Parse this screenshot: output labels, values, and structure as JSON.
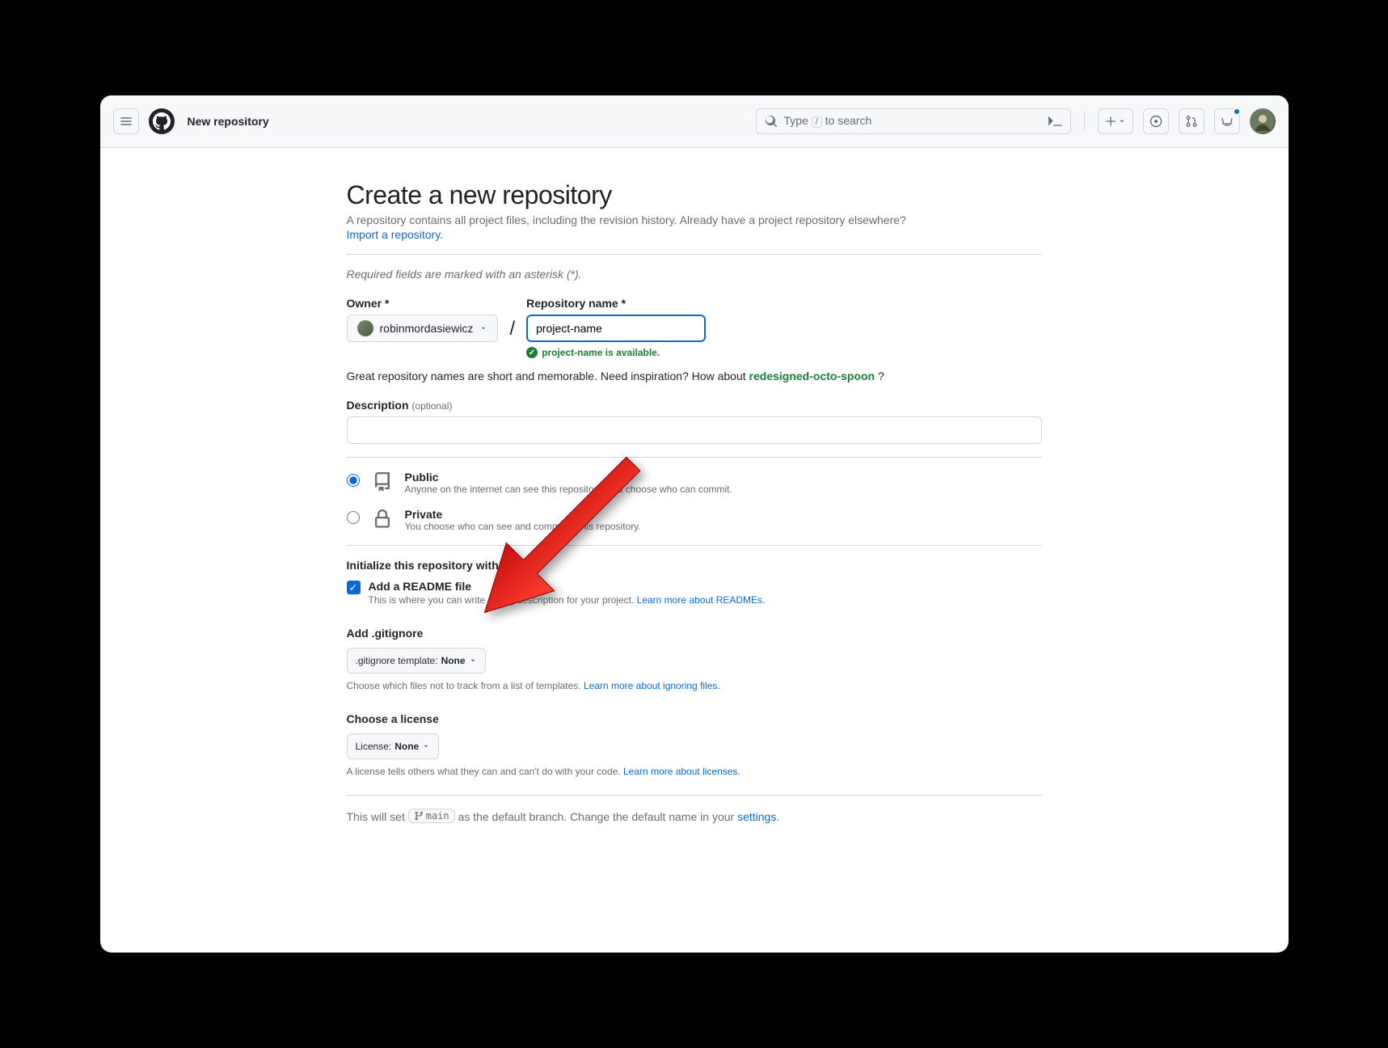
{
  "header": {
    "page_title": "New repository",
    "search_prefix": "Type",
    "search_key": "/",
    "search_suffix": "to search"
  },
  "form": {
    "heading": "Create a new repository",
    "subhead": "A repository contains all project files, including the revision history. Already have a project repository elsewhere?",
    "import_link": "Import a repository.",
    "required_note": "Required fields are marked with an asterisk (*).",
    "owner_label": "Owner *",
    "owner_value": "robinmordasiewicz",
    "slash": "/",
    "repo_name_label": "Repository name *",
    "repo_name_value": "project-name",
    "avail_msg": "project-name is available.",
    "inspire_pre": "Great repository names are short and memorable. Need inspiration? How about ",
    "inspire_suggestion": "redesigned-octo-spoon",
    "inspire_post": " ?",
    "desc_label": "Description",
    "desc_optional": "(optional)",
    "visibility": {
      "public": {
        "title": "Public",
        "desc": "Anyone on the internet can see this repository. You choose who can commit."
      },
      "private": {
        "title": "Private",
        "desc": "You choose who can see and commit to this repository."
      }
    },
    "init_heading": "Initialize this repository with:",
    "readme": {
      "label": "Add a README file",
      "desc": "This is where you can write a long description for your project. ",
      "link": "Learn more about READMEs."
    },
    "gitignore": {
      "heading": "Add .gitignore",
      "btn_prefix": ".gitignore template: ",
      "btn_value": "None",
      "help_pre": "Choose which files not to track from a list of templates. ",
      "help_link": "Learn more about ignoring files."
    },
    "license": {
      "heading": "Choose a license",
      "btn_prefix": "License: ",
      "btn_value": "None",
      "help_pre": "A license tells others what they can and can't do with your code. ",
      "help_link": "Learn more about licenses."
    },
    "branch": {
      "pre": "This will set ",
      "name": "main",
      "mid": " as the default branch. Change the default name in your ",
      "link": "settings",
      "post": "."
    }
  }
}
